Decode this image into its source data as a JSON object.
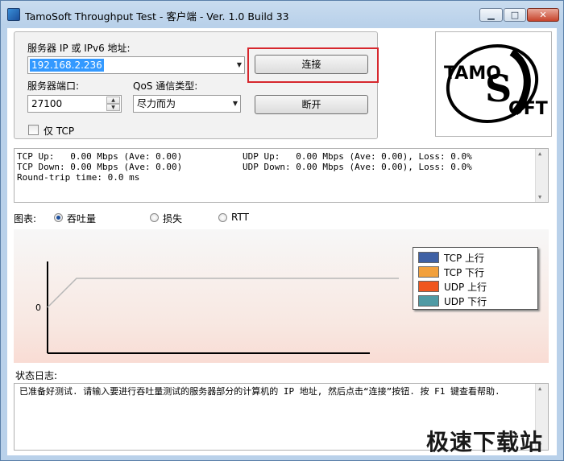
{
  "window": {
    "title": "TamoSoft Throughput Test - 客户端 - Ver. 1.0 Build 33",
    "min_glyph": "▁",
    "max_glyph": "□",
    "close_glyph": "✕"
  },
  "connection": {
    "server_label": "服务器 IP 或 IPv6 地址:",
    "server_value": "192.168.2.236",
    "port_label": "服务器端口:",
    "port_value": "27100",
    "qos_label": "QoS 通信类型:",
    "qos_value": "尽力而为",
    "tcp_only_label": "仅 TCP",
    "tcp_only_checked": false,
    "connect_label": "连接",
    "disconnect_label": "断开"
  },
  "logo": {
    "line1": "TAMO",
    "line2": "OFT"
  },
  "stats": {
    "tcp_up": "TCP Up:   0.00 Mbps (Ave: 0.00)",
    "tcp_down": "TCP Down: 0.00 Mbps (Ave: 0.00)",
    "rtt": "Round-trip time: 0.0 ms",
    "udp_up": "UDP Up:   0.00 Mbps (Ave: 0.00), Loss: 0.0%",
    "udp_down": "UDP Down: 0.00 Mbps (Ave: 0.00), Loss: 0.0%"
  },
  "chart_selector": {
    "label": "图表:",
    "options": [
      "吞吐量",
      "损失",
      "RTT"
    ],
    "selected": "吞吐量"
  },
  "chart_data": {
    "type": "line",
    "y_tick_labels": [
      "0"
    ],
    "series": [
      {
        "name": "TCP 上行",
        "color": "#3f61a5",
        "values": []
      },
      {
        "name": "TCP 下行",
        "color": "#f2a03c",
        "values": []
      },
      {
        "name": "UDP 上行",
        "color": "#f0561e",
        "values": []
      },
      {
        "name": "UDP 下行",
        "color": "#4f9aa4",
        "values": []
      }
    ],
    "legend_placement": "top-right",
    "grid": false
  },
  "log": {
    "label": "状态日志:",
    "text": "已准备好测试. 请输入要进行吞吐量测试的服务器部分的计算机的 IP 地址, 然后点击“连接”按钮. 按 F1 键查看帮助."
  },
  "watermark": "极速下载站"
}
